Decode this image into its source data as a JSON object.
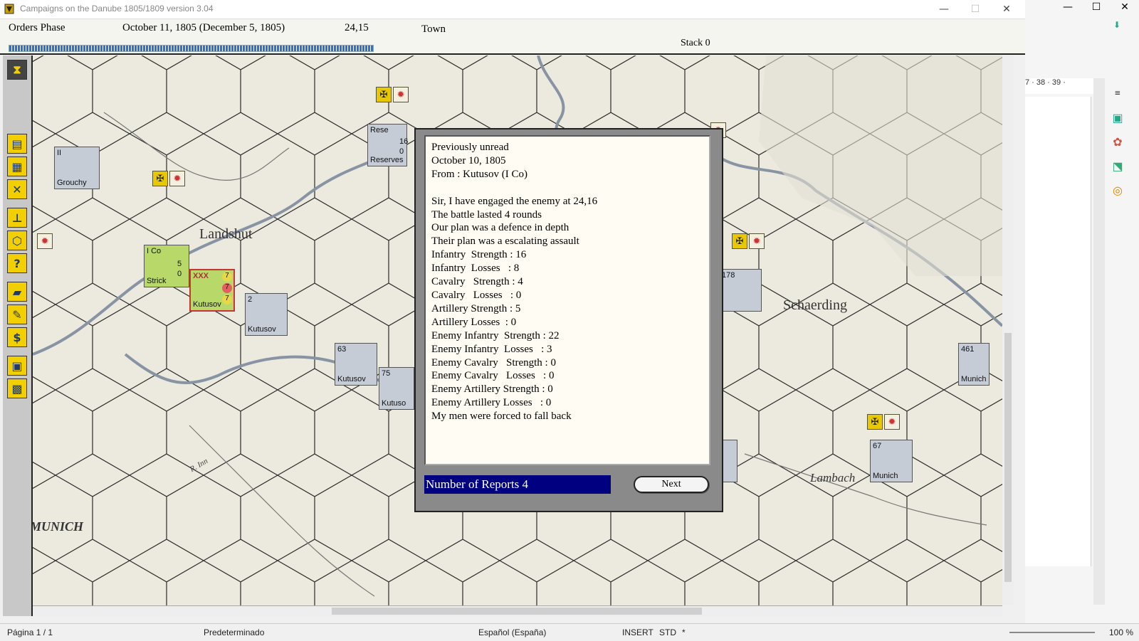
{
  "window": {
    "title": "Campaigns on the Danube 1805/1809  version 3.04",
    "minimize": "—",
    "maximize": "☐",
    "close": "✕"
  },
  "header": {
    "phase": "Orders Phase",
    "date": "October 11, 1805 (December 5, 1805)",
    "coords": "24,15",
    "terrain": "Town",
    "stack": "Stack 0",
    "progress_fraction": 0.37
  },
  "toolbar": {
    "icons": [
      "hourglass-icon",
      "messages-icon",
      "stack-icon",
      "swords-icon",
      "org-chart-icon",
      "hexagon-icon",
      "help-icon",
      "supply-icon",
      "supply-edit-icon",
      "money-icon",
      "strategy-icon",
      "map-grid-icon"
    ]
  },
  "map": {
    "places": {
      "landshut": "Landshut",
      "schaerding": "Schaerding",
      "lambach": "Lambach",
      "munich": "MUNICH",
      "inn": "R. Inn",
      "rissar": "R. Sa..."
    },
    "units": {
      "grouchy": {
        "num": "II",
        "label": "Grouchy"
      },
      "ico": {
        "num": "I Co",
        "label": "Strick",
        "v1": "5",
        "v2": "0"
      },
      "kutusov_hq": {
        "num": "XXX",
        "label": "Kutusov",
        "v1": "7",
        "v2": "7",
        "v3": "7"
      },
      "kutusov2": {
        "num": "2",
        "label": "Kutusov"
      },
      "kutusov63": {
        "num": "63",
        "label": "Kutusov"
      },
      "kutusov75": {
        "num": "75",
        "label": "Kutuso"
      },
      "reserves": {
        "num": "Rese",
        "label": "Reserves",
        "v1": "16",
        "v2": "0"
      },
      "u178": {
        "num": "178",
        "label": ""
      },
      "munich461": {
        "num": "461",
        "label": "Munich"
      },
      "munich67": {
        "num": "67",
        "label": "Munich"
      },
      "ch": {
        "num": "",
        "label": "ch"
      }
    }
  },
  "dialog": {
    "lines": [
      "Previously unread",
      "October 10, 1805",
      "From : Kutusov (I Co)",
      "",
      "Sir, I have engaged the enemy at 24,16",
      "The battle lasted 4 rounds",
      "Our plan was a defence in depth",
      "Their plan was a escalating assault",
      "Infantry  Strength : 16",
      "Infantry  Losses   : 8",
      "Cavalry   Strength : 4",
      "Cavalry   Losses   : 0",
      "Artillery Strength : 5",
      "Artillery Losses  : 0",
      "Enemy Infantry  Strength : 22",
      "Enemy Infantry  Losses   : 3",
      "Enemy Cavalry   Strength : 0",
      "Enemy Cavalry   Losses   : 0",
      "Enemy Artillery Strength : 0",
      "Enemy Artillery Losses   : 0",
      "My men were forced to fall back"
    ],
    "report_count": "Number of Reports 4",
    "next_label": "Next"
  },
  "word": {
    "ruler": "7 · 38 · 39 ·",
    "status": {
      "page": "Página  1 / 1",
      "style": "Predeterminado",
      "language": "Español (España)",
      "insert": "INSERT",
      "std": "STD",
      "star": "*",
      "zoom": "100 %"
    }
  }
}
